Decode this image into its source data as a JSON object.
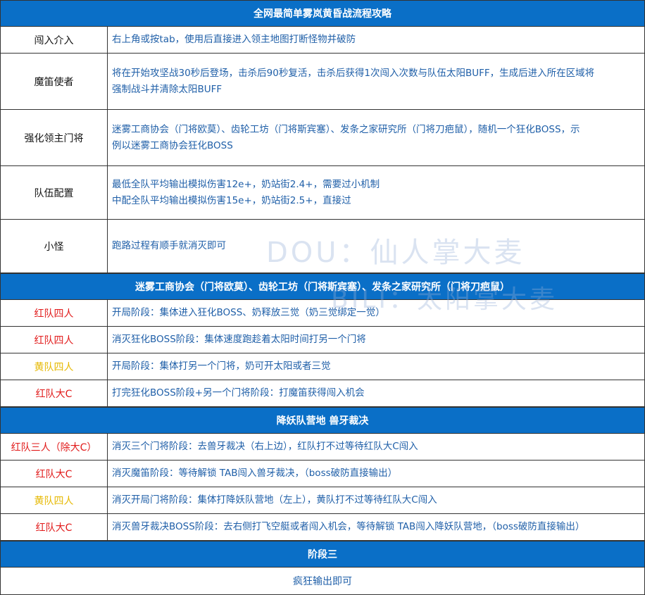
{
  "sections": [
    {
      "title": "全网最简单雾岚黄昏战流程攻略",
      "rows": [
        {
          "label": "闯入介入",
          "lines": [
            "右上角或按tab，使用后直接进入领主地图打断怪物并破防"
          ]
        },
        {
          "label": "魔笛使者",
          "lines": [
            "将在开始攻坚战30秒后登场，击杀后90秒复活，击杀后获得1次闯入次数与队伍太阳BUFF，生成后进入所在区域将",
            "强制战斗并清除太阳BUFF"
          ]
        },
        {
          "label": "强化领主门将",
          "lines": [
            "迷雾工商协会（门将欧莫）、齿轮工坊（门将斯宾塞）、发条之家研究所（门将刀疤鼠），随机一个狂化BOSS，示",
            "例以迷雾工商协会狂化BOSS"
          ]
        },
        {
          "label": "队伍配置",
          "lines": [
            "最低全队平均输出模拟伤害12e+，奶站街2.4+，需要过小机制",
            "中配全队平均输出模拟伤害15e+，奶站街2.5+，直接过"
          ]
        },
        {
          "label": "小怪",
          "lines": [
            "跑路过程有顺手就消灭即可"
          ]
        }
      ]
    },
    {
      "title": "迷雾工商协会（门将欧莫）、齿轮工坊（门将斯宾塞）、发条之家研究所（门将刀疤鼠）",
      "rows": [
        {
          "label": "红队四人",
          "color": "red",
          "lines": [
            "开局阶段：集体进入狂化BOSS、奶释放三觉（奶三觉绑定一觉）"
          ]
        },
        {
          "label": "红队四人",
          "color": "red",
          "lines": [
            "消灭狂化BOSS阶段：集体速度跑趁着太阳时间打另一个门将"
          ]
        },
        {
          "label": "黄队四人",
          "color": "yellow",
          "lines": [
            "开局阶段：集体打另一个门将，奶可开太阳或者三觉"
          ]
        },
        {
          "label": "红队大C",
          "color": "red",
          "lines": [
            "打完狂化BOSS阶段+另一个门将阶段：打魔笛获得闯入机会"
          ]
        }
      ]
    },
    {
      "title": "降妖队营地 兽牙裁决",
      "rows": [
        {
          "label": "红队三人（除大C）",
          "color": "red",
          "lines": [
            "消灭三个门将阶段：去兽牙裁决（右上边），红队打不过等待红队大C闯入"
          ]
        },
        {
          "label": "红队大C",
          "color": "red",
          "lines": [
            "消灭魔笛阶段：等待解锁 TAB闯入兽牙裁决，（boss破防直接输出）"
          ]
        },
        {
          "label": "黄队四人",
          "color": "yellow",
          "lines": [
            "消灭开局门将阶段：集体打降妖队营地（左上），黄队打不过等待红队大C闯入"
          ]
        },
        {
          "label": "红队大C",
          "color": "red",
          "lines": [
            "消灭兽牙裁决BOSS阶段：去右侧打飞空艇或者闯入机会，等待解锁 TAB闯入降妖队营地，（boss破防直接输出）"
          ]
        }
      ]
    },
    {
      "title": "阶段三",
      "span": "疯狂输出即可"
    }
  ],
  "watermarks": [
    "DOU：仙人掌大麦",
    "BILI：太阳掌大麦"
  ]
}
